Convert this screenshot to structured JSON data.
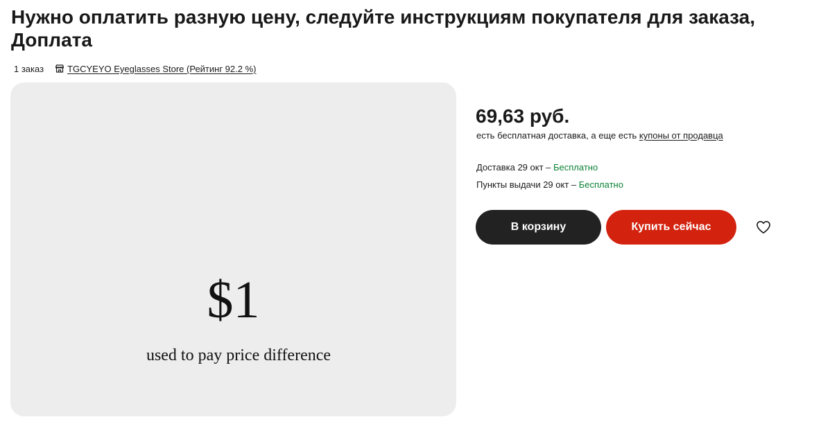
{
  "product": {
    "title": "Нужно оплатить разную цену, следуйте инструкциям покупателя для заказа, Доплата",
    "orders": "1 заказ",
    "store": "TGCYEYO Eyeglasses Store (Рейтинг 92.2 %)"
  },
  "image": {
    "price_text": "$1",
    "caption": "used to pay price difference"
  },
  "pricing": {
    "price": "69,63 руб.",
    "shipping_note": "есть бесплатная доставка, а еще есть ",
    "coupon_link": "купоны от продавца"
  },
  "delivery": {
    "label": "Доставка 29 окт – ",
    "value": "Бесплатно"
  },
  "pickup": {
    "label": "Пункты выдачи 29 окт – ",
    "value": "Бесплатно"
  },
  "actions": {
    "cart_label": "В корзину",
    "buy_label": "Купить сейчас"
  },
  "icons": {
    "store": "store-icon",
    "wishlist": "heart-icon"
  },
  "colors": {
    "cart_button": "#222222",
    "buy_button": "#d3230f",
    "free_text": "#0b8235",
    "image_background": "#ededed"
  }
}
